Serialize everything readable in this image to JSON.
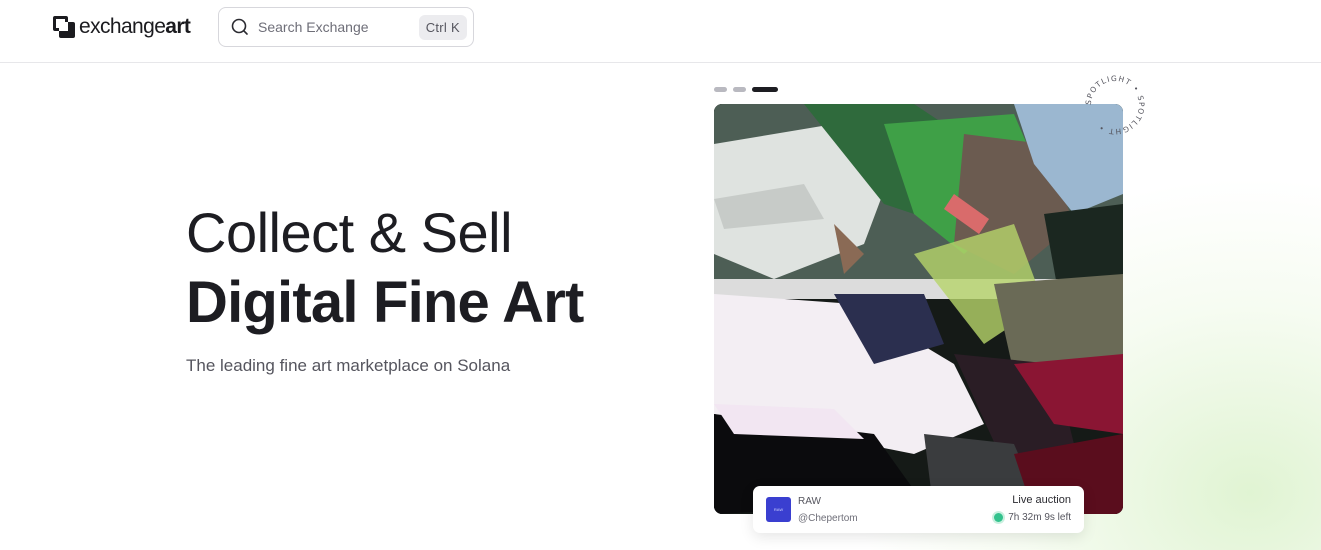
{
  "header": {
    "logo_text_light": "exchange",
    "logo_text_bold": "art",
    "search": {
      "placeholder": "Search Exchange",
      "shortcut": "Ctrl K"
    }
  },
  "hero": {
    "line1": "Collect & Sell",
    "line2": "Digital Fine Art",
    "subtitle": "The leading fine art marketplace on Solana"
  },
  "spotlight": {
    "badge_text": "SPOTLIGHT • SPOTLIGHT •",
    "carousel": {
      "count": 3,
      "active_index": 2
    },
    "card": {
      "avatar_text": "RAW",
      "title": "RAW",
      "handle": "@Chepertom",
      "status": "Live auction",
      "time_left": "7h 32m 9s left"
    }
  },
  "colors": {
    "text": "#1d1d22",
    "muted": "#55555e",
    "live": "#33c28d",
    "avatar": "#3a3fd0",
    "glow": "#d6f0c4"
  },
  "icons": [
    "search-icon",
    "logo-icon",
    "live-dot-icon"
  ]
}
